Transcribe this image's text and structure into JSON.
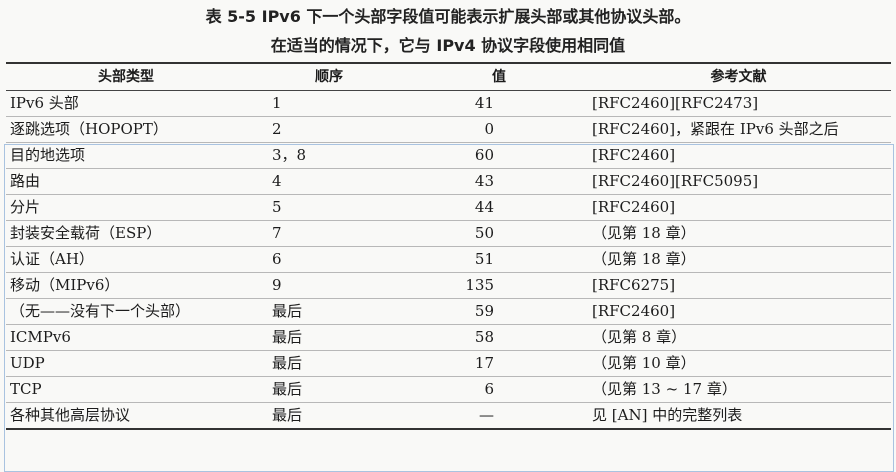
{
  "caption": {
    "line1": "表 5-5   IPv6 下一个头部字段值可能表示扩展头部或其他协议头部。",
    "line2": "在适当的情况下，它与 IPv4 协议字段使用相同值"
  },
  "table": {
    "headers": [
      "头部类型",
      "顺序",
      "值",
      "参考文献"
    ],
    "rows": [
      [
        "IPv6 头部",
        "1",
        "41",
        "[RFC2460][RFC2473]"
      ],
      [
        "逐跳选项（HOPOPT）",
        "2",
        "0",
        "[RFC2460]，紧跟在 IPv6 头部之后"
      ],
      [
        "目的地选项",
        "3，8",
        "60",
        "[RFC2460]"
      ],
      [
        "路由",
        "4",
        "43",
        "[RFC2460][RFC5095]"
      ],
      [
        "分片",
        "5",
        "44",
        "[RFC2460]"
      ],
      [
        "封装安全载荷（ESP）",
        "7",
        "50",
        "（见第 18 章）"
      ],
      [
        "认证（AH）",
        "6",
        "51",
        "（见第 18 章）"
      ],
      [
        "移动（MIPv6）",
        "9",
        "135",
        "[RFC6275]"
      ],
      [
        "（无——没有下一个头部）",
        "最后",
        "59",
        "[RFC2460]"
      ],
      [
        "ICMPv6",
        "最后",
        "58",
        "（见第 8 章）"
      ],
      [
        "UDP",
        "最后",
        "17",
        "（见第 10 章）"
      ],
      [
        "TCP",
        "最后",
        "6",
        "（见第 13 ~ 17 章）"
      ],
      [
        "各种其他高层协议",
        "最后",
        "—",
        "见 [AN] 中的完整列表"
      ]
    ]
  }
}
